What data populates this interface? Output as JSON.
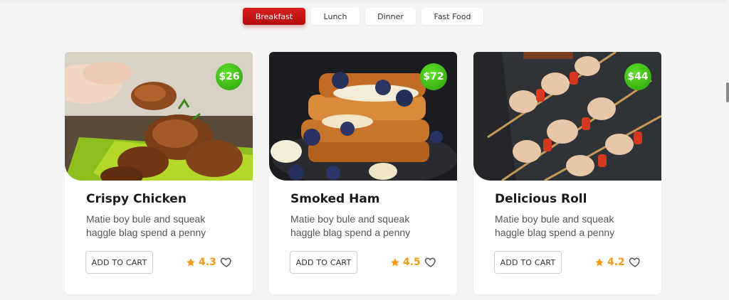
{
  "tabs": [
    {
      "label": "Breakfast",
      "active": true
    },
    {
      "label": "Lunch",
      "active": false
    },
    {
      "label": "Dinner",
      "active": false
    },
    {
      "label": "Fast Food",
      "active": false
    }
  ],
  "cards": [
    {
      "title": "Crispy Chicken",
      "price": "$26",
      "desc": "Matie boy bule and squeak haggle blag spend a penny",
      "cart_label": "ADD TO CART",
      "rating": "4.3",
      "image_icon": "fried-chicken-photo"
    },
    {
      "title": "Smoked Ham",
      "price": "$72",
      "desc": "Matie boy bule and squeak haggle blag spend a penny",
      "cart_label": "ADD TO CART",
      "rating": "4.5",
      "image_icon": "french-toast-photo"
    },
    {
      "title": "Delicious Roll",
      "price": "$44",
      "desc": "Matie boy bule and squeak haggle blag spend a penny",
      "cart_label": "ADD TO CART",
      "rating": "4.2",
      "image_icon": "kebab-skewers-photo"
    }
  ],
  "colors": {
    "accent": "#c81414",
    "price_badge": "#3cbf14",
    "star": "#f29a12"
  }
}
